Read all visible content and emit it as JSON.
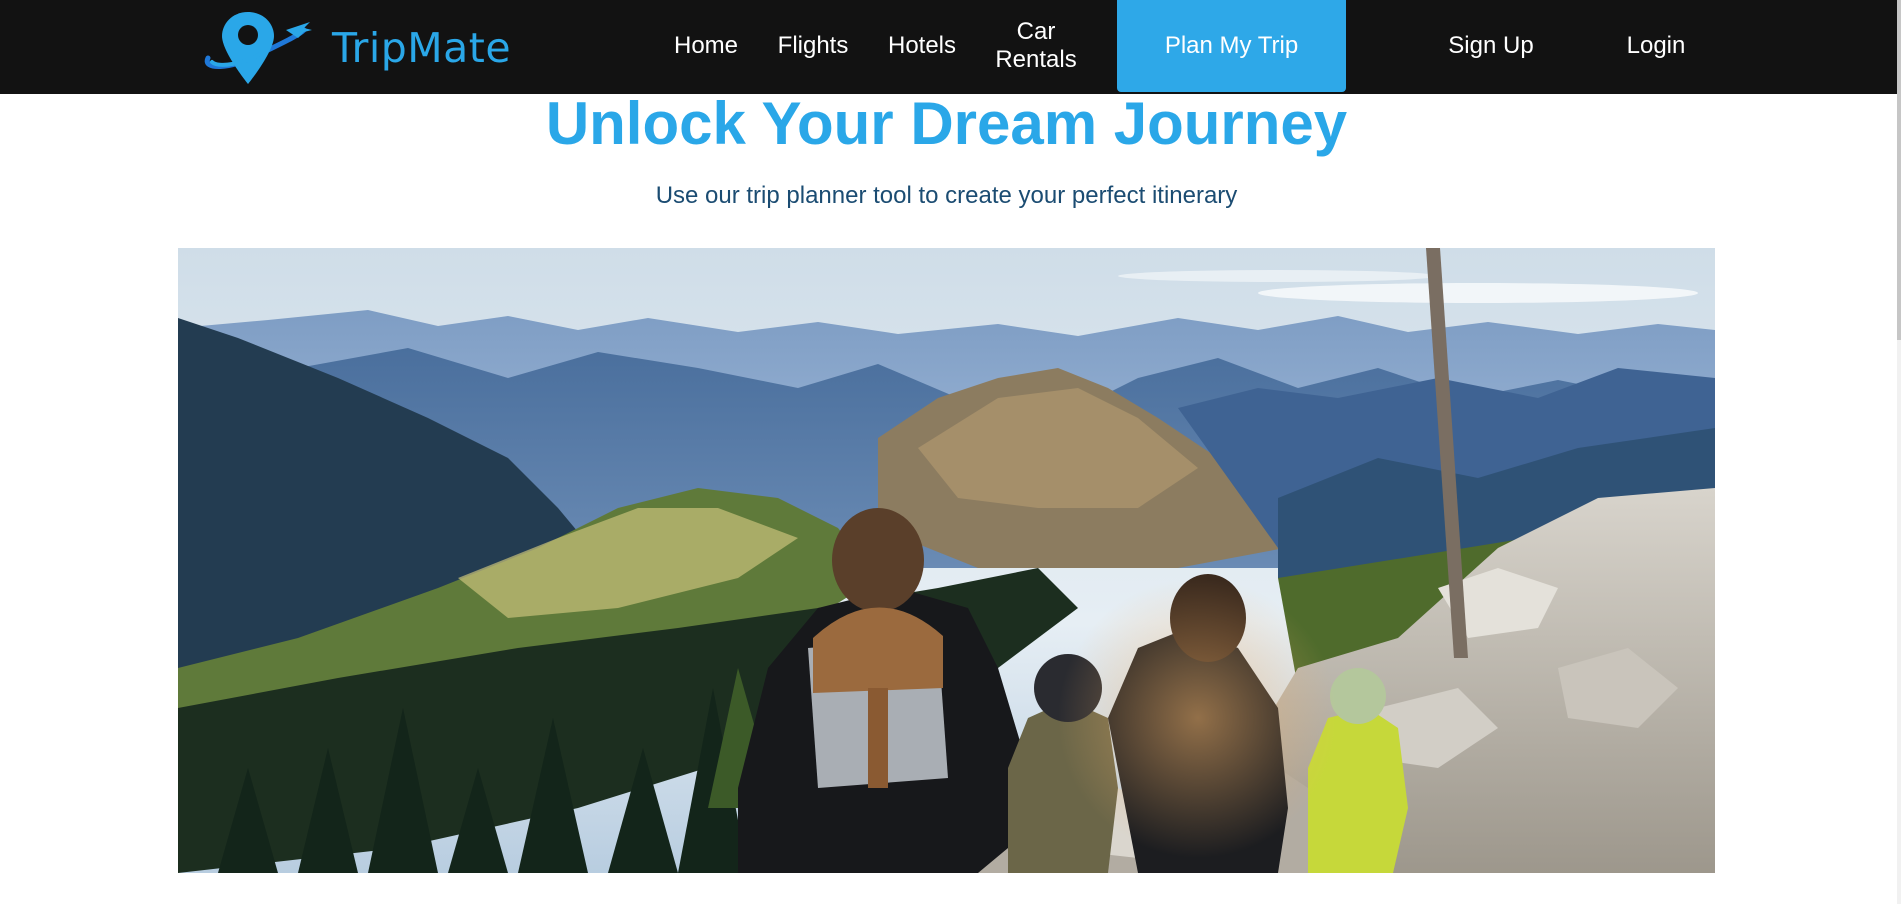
{
  "brand": {
    "name": "TripMate",
    "logo_icon": "map-pin-orbit-plane-icon",
    "color": "#2aa7e8"
  },
  "nav": {
    "home": "Home",
    "flights": "Flights",
    "hotels": "Hotels",
    "car_rentals_line1": "Car",
    "car_rentals_line2": "Rentals",
    "plan_my_trip": "Plan My Trip",
    "sign_up": "Sign Up",
    "login": "Login"
  },
  "hero": {
    "title": "Unlock Your Dream Journey",
    "subtitle": "Use our trip planner tool to create your perfect itinerary",
    "image_subject": "family-on-mountain-overlook-photo"
  },
  "colors": {
    "nav_background": "#121212",
    "accent": "#2ea8e8",
    "subtitle": "#1b4c72"
  }
}
